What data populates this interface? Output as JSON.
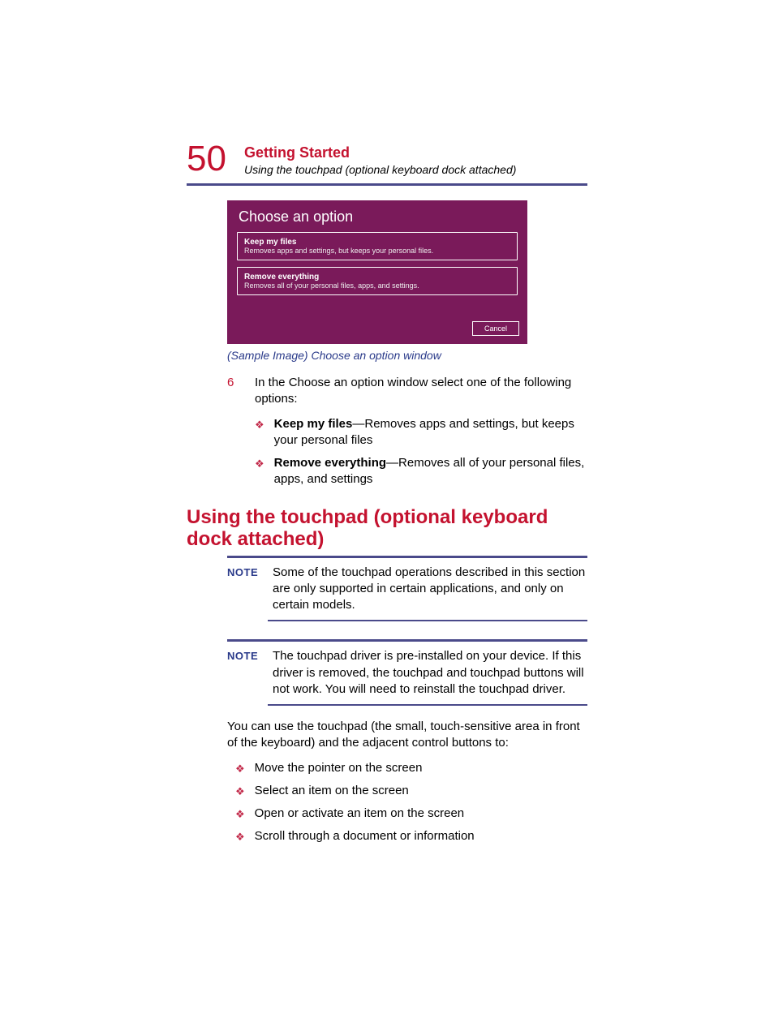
{
  "page_number": "50",
  "header": {
    "chapter": "Getting Started",
    "section": "Using the touchpad (optional keyboard dock attached)"
  },
  "sample_window": {
    "title": "Choose an option",
    "options": [
      {
        "title": "Keep my files",
        "desc": "Removes apps and settings, but keeps your personal files."
      },
      {
        "title": "Remove everything",
        "desc": "Removes all of your personal files, apps, and settings."
      }
    ],
    "cancel": "Cancel"
  },
  "caption": "(Sample Image) Choose an option window",
  "step": {
    "num": "6",
    "text": "In the Choose an option window select one of the following options:"
  },
  "option_bullets": [
    {
      "bold": "Keep my files",
      "rest": "—Removes apps and settings, but keeps your personal files"
    },
    {
      "bold": "Remove everything",
      "rest": "—Removes all of your personal files, apps, and settings"
    }
  ],
  "section_heading": "Using the touchpad (optional keyboard dock attached)",
  "notes": [
    {
      "label": "NOTE",
      "text": "Some of the touchpad operations described in this section are only supported in certain applications, and only on certain models."
    },
    {
      "label": "NOTE",
      "text": "The touchpad driver is pre-installed on your device. If this driver is removed, the touchpad and touchpad buttons will not work. You will need to reinstall the touchpad driver."
    }
  ],
  "paragraph": "You can use the touchpad (the small, touch-sensitive area in front of the keyboard) and the adjacent control buttons to:",
  "action_bullets": [
    "Move the pointer on the screen",
    "Select an item on the screen",
    "Open or activate an item on the screen",
    "Scroll through a document or information"
  ]
}
